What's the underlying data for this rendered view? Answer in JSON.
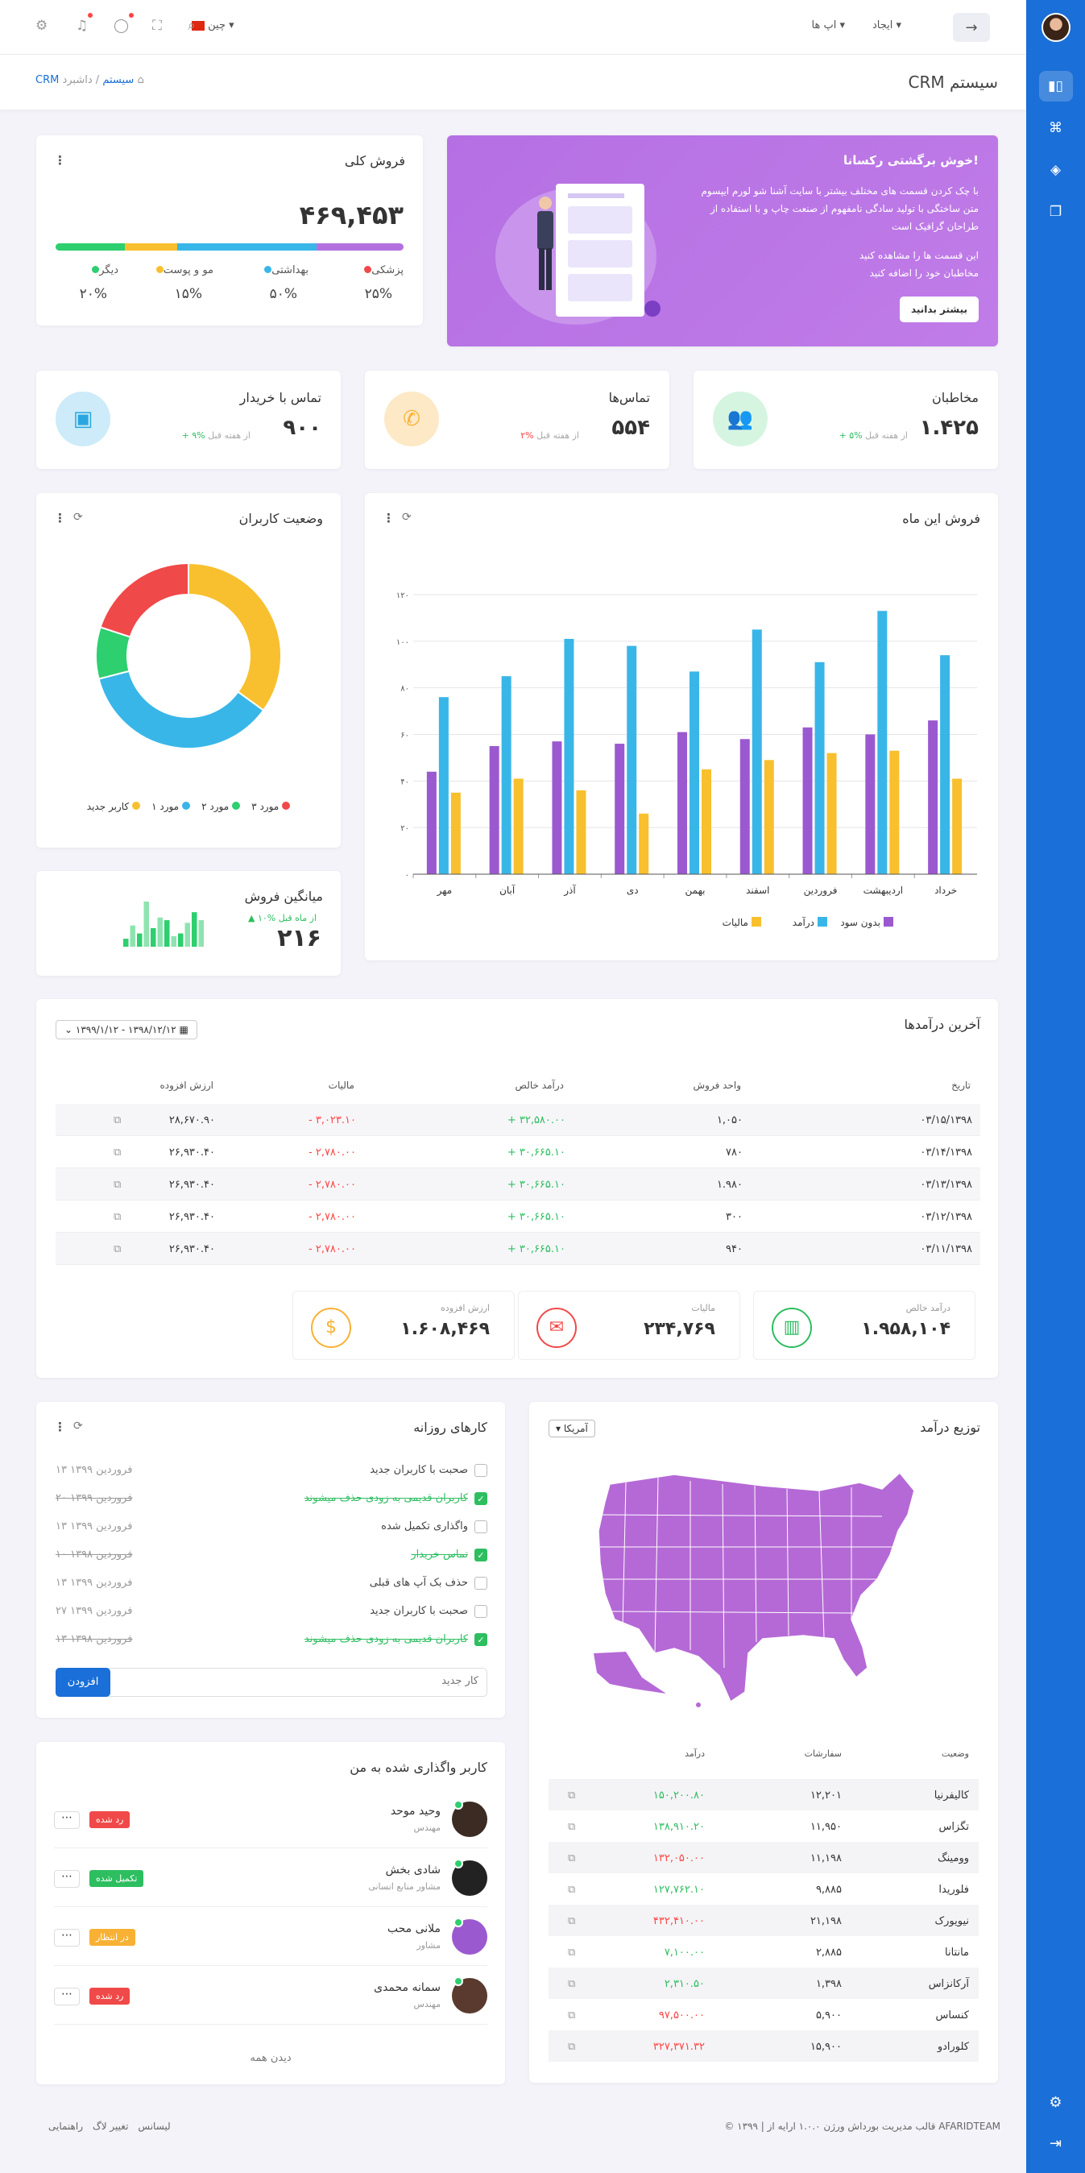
{
  "topbar": {
    "create": "ایجاد",
    "apps": "اپ ها",
    "lang": "چین"
  },
  "breadcrumb": {
    "page_title": "CRM سیستم",
    "home": "داشبرد",
    "current": "CRM سیستم"
  },
  "welcome": {
    "title": "خوش برگشتی رکسانا!",
    "text1": "با چک کردن قسمت های مختلف بیشتر با سایت آشنا شو لورم ایپسوم متن ساختگی با تولید سادگی نامفهوم از صنعت چاپ و با استفاده از طراحان گرافیک است",
    "text2": "این قسمت ها را مشاهده کنید",
    "text3": "مخاطبان خود را اضافه کنید",
    "button": "بیشتر بدانید"
  },
  "total_sales": {
    "title": "فروش کلی",
    "value": "۴۶۹,۴۵۳",
    "segments": [
      {
        "label": "پزشکی",
        "pct": "۲۵%",
        "color": "#f04949"
      },
      {
        "label": "بهداشتی",
        "pct": "۵۰%",
        "color": "#39b6e8"
      },
      {
        "label": "مو و پوست",
        "pct": "۱۵%",
        "color": "#f8c02e"
      },
      {
        "label": "دیگر",
        "pct": "۲۰%",
        "color": "#2dcf6e"
      }
    ]
  },
  "stats": [
    {
      "title": "مخاطبان",
      "value": "۱.۴۲۵",
      "change": "+ ۵%",
      "period": "از هفته قبل",
      "icon": "users-icon",
      "color": "#2dcf6e",
      "bg": "#d6f5e1",
      "dir": "green"
    },
    {
      "title": "تماس‌ها",
      "value": "۵۵۴",
      "change": "۲%",
      "period": "از هفته قبل",
      "icon": "phone-icon",
      "color": "#f8b134",
      "bg": "#fde9c6",
      "dir": "red"
    },
    {
      "title": "تماس با خریدار",
      "value": "۹۰۰",
      "change": "+ ۹%",
      "period": "از هفته قبل",
      "icon": "money-icon",
      "color": "#2aa7e0",
      "bg": "#cdebf8",
      "dir": "green"
    }
  ],
  "users_status": {
    "title": "وضعیت کاربران",
    "legend": [
      {
        "label": "مورد ۳",
        "color": "#f04949"
      },
      {
        "label": "مورد ۲",
        "color": "#2dcf6e"
      },
      {
        "label": "مورد ۱",
        "color": "#39b6e8"
      },
      {
        "label": "کاربر جدید",
        "color": "#f8c02e"
      }
    ]
  },
  "avg_sales": {
    "title": "میانگین فروش",
    "value": "۲۱۶",
    "change": "۱۰% از ماه قبل"
  },
  "chart_data": [
    {
      "type": "bar",
      "title": "فروش این ماه",
      "categories": [
        "خرداد",
        "اردیبهشت",
        "فروردین",
        "اسفند",
        "بهمن",
        "دی",
        "آذر",
        "آبان",
        "مهر"
      ],
      "ylim": [
        0,
        120
      ],
      "yticks": [
        "۰",
        "۲۰",
        "۴۰",
        "۶۰",
        "۸۰",
        "۱۰۰",
        "۱۲۰"
      ],
      "series": [
        {
          "name": "بدون سود",
          "color": "#9b59d0",
          "values": [
            66,
            60,
            63,
            58,
            61,
            56,
            57,
            55,
            44
          ]
        },
        {
          "name": "درآمد",
          "color": "#39b6e8",
          "values": [
            94,
            113,
            91,
            105,
            87,
            98,
            101,
            85,
            76
          ]
        },
        {
          "name": "مالیات",
          "color": "#f8c02e",
          "values": [
            41,
            53,
            52,
            49,
            45,
            26,
            36,
            41,
            35
          ]
        }
      ]
    },
    {
      "type": "pie",
      "title": "وضعیت کاربران",
      "categories": [
        "کاربر جدید",
        "مورد ۱",
        "مورد ۲",
        "مورد ۳"
      ],
      "values": [
        35,
        36,
        9,
        20
      ]
    },
    {
      "type": "bar",
      "title": "میانگین فروش",
      "values": [
        3,
        8,
        5,
        17,
        7,
        11,
        10,
        4,
        5,
        9,
        13,
        10
      ]
    }
  ],
  "revenue": {
    "title": "آخرین درآمدها",
    "date_range": "۱۳۹۹/۱/۱۲ - ۱۳۹۸/۱۲/۱۲",
    "headers": [
      "تاریخ",
      "واحد فروش",
      "درآمد خالص",
      "مالیات",
      "ارزش افزوده"
    ],
    "rows": [
      [
        "۰۳/۱۵/۱۳۹۸",
        "۱,۰۵۰",
        "+ ۳۲,۵۸۰.۰۰",
        "- ۳,۰۲۳.۱۰",
        "۲۸,۶۷۰.۹۰"
      ],
      [
        "۰۳/۱۴/۱۳۹۸",
        "۷۸۰",
        "+ ۳۰,۶۶۵.۱۰",
        "- ۲,۷۸۰.۰۰",
        "۲۶,۹۳۰.۴۰"
      ],
      [
        "۰۳/۱۳/۱۳۹۸",
        "۱.۹۸۰",
        "+ ۳۰,۶۶۵.۱۰",
        "- ۲,۷۸۰.۰۰",
        "۲۶,۹۳۰.۴۰"
      ],
      [
        "۰۳/۱۲/۱۳۹۸",
        "۳۰۰",
        "+ ۳۰,۶۶۵.۱۰",
        "- ۲,۷۸۰.۰۰",
        "۲۶,۹۳۰.۴۰"
      ],
      [
        "۰۳/۱۱/۱۳۹۸",
        "۹۴۰",
        "+ ۳۰,۶۶۵.۱۰",
        "- ۲,۷۸۰.۰۰",
        "۲۶,۹۳۰.۴۰"
      ]
    ],
    "summary": [
      {
        "label": "درآمد خالص",
        "value": "۱.۹۵۸,۱۰۴",
        "color": "#2dbe60",
        "icon": "chart-icon"
      },
      {
        "label": "مالیات",
        "value": "۲۳۴,۷۶۹",
        "color": "#f04949",
        "icon": "receipt-icon"
      },
      {
        "label": "ارزش افزوده",
        "value": "۱.۶۰۸,۴۶۹",
        "color": "#f8b134",
        "icon": "dollar-icon"
      }
    ]
  },
  "distribution": {
    "title": "توزیع درآمد",
    "country": "آمریکا",
    "headers": [
      "وضعیت",
      "سفارشات",
      "درآمد"
    ],
    "rows": [
      [
        "کالیفرنیا",
        "۱۲,۲۰۱",
        "۱۵۰,۲۰۰.۸۰",
        "green"
      ],
      [
        "تگزاس",
        "۱۱,۹۵۰",
        "۱۳۸,۹۱۰.۲۰",
        "green"
      ],
      [
        "وومینگ",
        "۱۱,۱۹۸",
        "۱۳۲,۰۵۰.۰۰",
        "red"
      ],
      [
        "فلوریدا",
        "۹,۸۸۵",
        "۱۲۷,۷۶۲.۱۰",
        "green"
      ],
      [
        "نیویورک",
        "۲۱,۱۹۸",
        "۴۳۲,۴۱۰.۰۰",
        "red"
      ],
      [
        "مانتانا",
        "۲,۸۸۵",
        "۷,۱۰۰.۰۰",
        "green"
      ],
      [
        "آرکانزاس",
        "۱,۳۹۸",
        "۲,۳۱۰.۵۰",
        "green"
      ],
      [
        "کنساس",
        "۵,۹۰۰",
        "۹۷,۵۰۰.۰۰",
        "red"
      ],
      [
        "کلورادو",
        "۱۵,۹۰۰",
        "۳۲۷,۳۷۱.۳۲",
        "red"
      ]
    ]
  },
  "daily": {
    "title": "کارهای روزانه",
    "items": [
      {
        "text": "صحبت با کاربران جدید",
        "date": "۱۳ فروردین ۱۳۹۹",
        "done": false
      },
      {
        "text": "کاربران قدیمی به زودی حذف میشوند",
        "date": "۲۰ فروردین ۱۳۹۹",
        "done": true
      },
      {
        "text": "واگذاری تکمیل شده",
        "date": "۱۳ فروردین ۱۳۹۹",
        "done": false
      },
      {
        "text": "تماس خریدار",
        "date": "۱۰ فروردین ۱۳۹۸",
        "done": true
      },
      {
        "text": "حذف بک آپ های قبلی",
        "date": "۱۳ فروردین ۱۳۹۹",
        "done": false
      },
      {
        "text": "صحبت با کاربران جدید",
        "date": "۲۷ فروردین ۱۳۹۹",
        "done": false
      },
      {
        "text": "کاربران قدیمی به زودی حذف میشوند",
        "date": "۱۳ فروردین ۱۳۹۸",
        "done": true
      }
    ],
    "placeholder": "کار جدید",
    "add": "افزودن"
  },
  "assigned": {
    "title": "کاربر واگذاری شده به من",
    "users": [
      {
        "name": "وحید موحد",
        "role": "مهندس",
        "badge": "رد شده",
        "color": "#f04949",
        "avatar": "#3b2b22"
      },
      {
        "name": "شادی بخش",
        "role": "مشاور منابع انسانی",
        "badge": "تکمیل شده",
        "color": "#2dbe60",
        "avatar": "#222"
      },
      {
        "name": "ملانی محب",
        "role": "مشاور",
        "badge": "در انتظار",
        "color": "#f8b134",
        "avatar": "#9b59d0"
      },
      {
        "name": "سمانه محمدی",
        "role": "مهندس",
        "badge": "رد شده",
        "color": "#f04949",
        "avatar": "#5a3a2e"
      }
    ],
    "more_icon": "⋯",
    "see_all": "دیدن همه"
  },
  "footer": {
    "copyright": "© ۱۳۹۹ | قالب مدیریت بورداش ورژن ۱.۰.۰ ارایه از AFARIDTEAM",
    "links": [
      "لیسانس",
      "تغییر لاگ",
      "راهنمایی"
    ]
  }
}
